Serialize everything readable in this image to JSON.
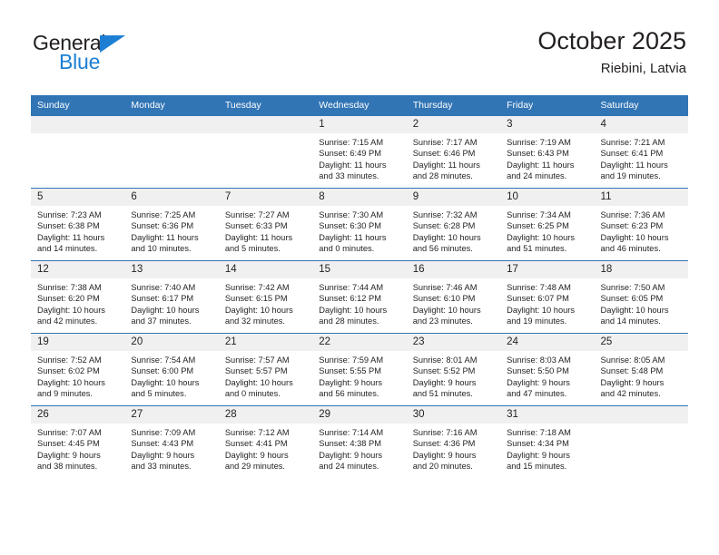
{
  "brand": {
    "name_top": "General",
    "name_bottom": "Blue"
  },
  "header": {
    "title": "October 2025",
    "location": "Riebini, Latvia"
  },
  "weekday_headers": [
    "Sunday",
    "Monday",
    "Tuesday",
    "Wednesday",
    "Thursday",
    "Friday",
    "Saturday"
  ],
  "colors": {
    "header_blue": "#3175b5",
    "daynum_gray": "#f0f0f0",
    "text": "#231f20",
    "brand_blue": "#1c7fd4"
  },
  "weeks": [
    [
      {
        "day": "",
        "lines": []
      },
      {
        "day": "",
        "lines": []
      },
      {
        "day": "",
        "lines": []
      },
      {
        "day": "1",
        "lines": [
          "Sunrise: 7:15 AM",
          "Sunset: 6:49 PM",
          "Daylight: 11 hours",
          "and 33 minutes."
        ]
      },
      {
        "day": "2",
        "lines": [
          "Sunrise: 7:17 AM",
          "Sunset: 6:46 PM",
          "Daylight: 11 hours",
          "and 28 minutes."
        ]
      },
      {
        "day": "3",
        "lines": [
          "Sunrise: 7:19 AM",
          "Sunset: 6:43 PM",
          "Daylight: 11 hours",
          "and 24 minutes."
        ]
      },
      {
        "day": "4",
        "lines": [
          "Sunrise: 7:21 AM",
          "Sunset: 6:41 PM",
          "Daylight: 11 hours",
          "and 19 minutes."
        ]
      }
    ],
    [
      {
        "day": "5",
        "lines": [
          "Sunrise: 7:23 AM",
          "Sunset: 6:38 PM",
          "Daylight: 11 hours",
          "and 14 minutes."
        ]
      },
      {
        "day": "6",
        "lines": [
          "Sunrise: 7:25 AM",
          "Sunset: 6:36 PM",
          "Daylight: 11 hours",
          "and 10 minutes."
        ]
      },
      {
        "day": "7",
        "lines": [
          "Sunrise: 7:27 AM",
          "Sunset: 6:33 PM",
          "Daylight: 11 hours",
          "and 5 minutes."
        ]
      },
      {
        "day": "8",
        "lines": [
          "Sunrise: 7:30 AM",
          "Sunset: 6:30 PM",
          "Daylight: 11 hours",
          "and 0 minutes."
        ]
      },
      {
        "day": "9",
        "lines": [
          "Sunrise: 7:32 AM",
          "Sunset: 6:28 PM",
          "Daylight: 10 hours",
          "and 56 minutes."
        ]
      },
      {
        "day": "10",
        "lines": [
          "Sunrise: 7:34 AM",
          "Sunset: 6:25 PM",
          "Daylight: 10 hours",
          "and 51 minutes."
        ]
      },
      {
        "day": "11",
        "lines": [
          "Sunrise: 7:36 AM",
          "Sunset: 6:23 PM",
          "Daylight: 10 hours",
          "and 46 minutes."
        ]
      }
    ],
    [
      {
        "day": "12",
        "lines": [
          "Sunrise: 7:38 AM",
          "Sunset: 6:20 PM",
          "Daylight: 10 hours",
          "and 42 minutes."
        ]
      },
      {
        "day": "13",
        "lines": [
          "Sunrise: 7:40 AM",
          "Sunset: 6:17 PM",
          "Daylight: 10 hours",
          "and 37 minutes."
        ]
      },
      {
        "day": "14",
        "lines": [
          "Sunrise: 7:42 AM",
          "Sunset: 6:15 PM",
          "Daylight: 10 hours",
          "and 32 minutes."
        ]
      },
      {
        "day": "15",
        "lines": [
          "Sunrise: 7:44 AM",
          "Sunset: 6:12 PM",
          "Daylight: 10 hours",
          "and 28 minutes."
        ]
      },
      {
        "day": "16",
        "lines": [
          "Sunrise: 7:46 AM",
          "Sunset: 6:10 PM",
          "Daylight: 10 hours",
          "and 23 minutes."
        ]
      },
      {
        "day": "17",
        "lines": [
          "Sunrise: 7:48 AM",
          "Sunset: 6:07 PM",
          "Daylight: 10 hours",
          "and 19 minutes."
        ]
      },
      {
        "day": "18",
        "lines": [
          "Sunrise: 7:50 AM",
          "Sunset: 6:05 PM",
          "Daylight: 10 hours",
          "and 14 minutes."
        ]
      }
    ],
    [
      {
        "day": "19",
        "lines": [
          "Sunrise: 7:52 AM",
          "Sunset: 6:02 PM",
          "Daylight: 10 hours",
          "and 9 minutes."
        ]
      },
      {
        "day": "20",
        "lines": [
          "Sunrise: 7:54 AM",
          "Sunset: 6:00 PM",
          "Daylight: 10 hours",
          "and 5 minutes."
        ]
      },
      {
        "day": "21",
        "lines": [
          "Sunrise: 7:57 AM",
          "Sunset: 5:57 PM",
          "Daylight: 10 hours",
          "and 0 minutes."
        ]
      },
      {
        "day": "22",
        "lines": [
          "Sunrise: 7:59 AM",
          "Sunset: 5:55 PM",
          "Daylight: 9 hours",
          "and 56 minutes."
        ]
      },
      {
        "day": "23",
        "lines": [
          "Sunrise: 8:01 AM",
          "Sunset: 5:52 PM",
          "Daylight: 9 hours",
          "and 51 minutes."
        ]
      },
      {
        "day": "24",
        "lines": [
          "Sunrise: 8:03 AM",
          "Sunset: 5:50 PM",
          "Daylight: 9 hours",
          "and 47 minutes."
        ]
      },
      {
        "day": "25",
        "lines": [
          "Sunrise: 8:05 AM",
          "Sunset: 5:48 PM",
          "Daylight: 9 hours",
          "and 42 minutes."
        ]
      }
    ],
    [
      {
        "day": "26",
        "lines": [
          "Sunrise: 7:07 AM",
          "Sunset: 4:45 PM",
          "Daylight: 9 hours",
          "and 38 minutes."
        ]
      },
      {
        "day": "27",
        "lines": [
          "Sunrise: 7:09 AM",
          "Sunset: 4:43 PM",
          "Daylight: 9 hours",
          "and 33 minutes."
        ]
      },
      {
        "day": "28",
        "lines": [
          "Sunrise: 7:12 AM",
          "Sunset: 4:41 PM",
          "Daylight: 9 hours",
          "and 29 minutes."
        ]
      },
      {
        "day": "29",
        "lines": [
          "Sunrise: 7:14 AM",
          "Sunset: 4:38 PM",
          "Daylight: 9 hours",
          "and 24 minutes."
        ]
      },
      {
        "day": "30",
        "lines": [
          "Sunrise: 7:16 AM",
          "Sunset: 4:36 PM",
          "Daylight: 9 hours",
          "and 20 minutes."
        ]
      },
      {
        "day": "31",
        "lines": [
          "Sunrise: 7:18 AM",
          "Sunset: 4:34 PM",
          "Daylight: 9 hours",
          "and 15 minutes."
        ]
      },
      {
        "day": "",
        "lines": []
      }
    ]
  ]
}
